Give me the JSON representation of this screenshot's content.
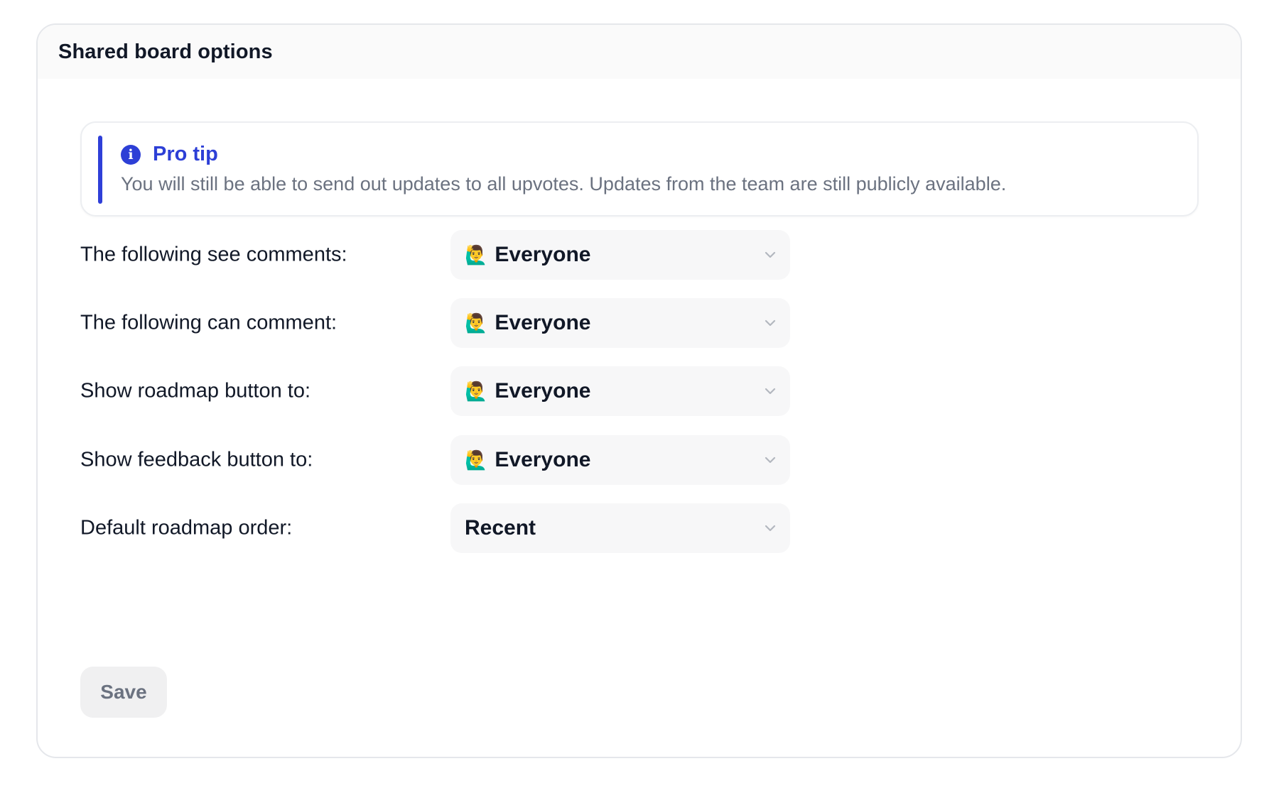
{
  "card": {
    "title": "Shared board options"
  },
  "tip": {
    "icon": "info-icon",
    "title": "Pro tip",
    "text": "You will still be able to send out updates to all upvotes. Updates from the team are still publicly available.",
    "accent": "#2d3fd6"
  },
  "rows": [
    {
      "label": "The following see comments:",
      "emoji": "🙋‍♂️",
      "value": "Everyone"
    },
    {
      "label": "The following can comment:",
      "emoji": "🙋‍♂️",
      "value": "Everyone"
    },
    {
      "label": "Show roadmap button to:",
      "emoji": "🙋‍♂️",
      "value": "Everyone"
    },
    {
      "label": "Show feedback button to:",
      "emoji": "🙋‍♂️",
      "value": "Everyone"
    },
    {
      "label": "Default roadmap order:",
      "emoji": "",
      "value": "Recent"
    }
  ],
  "save": {
    "label": "Save"
  },
  "icons": {
    "dropdown": "chevron-down-icon"
  }
}
